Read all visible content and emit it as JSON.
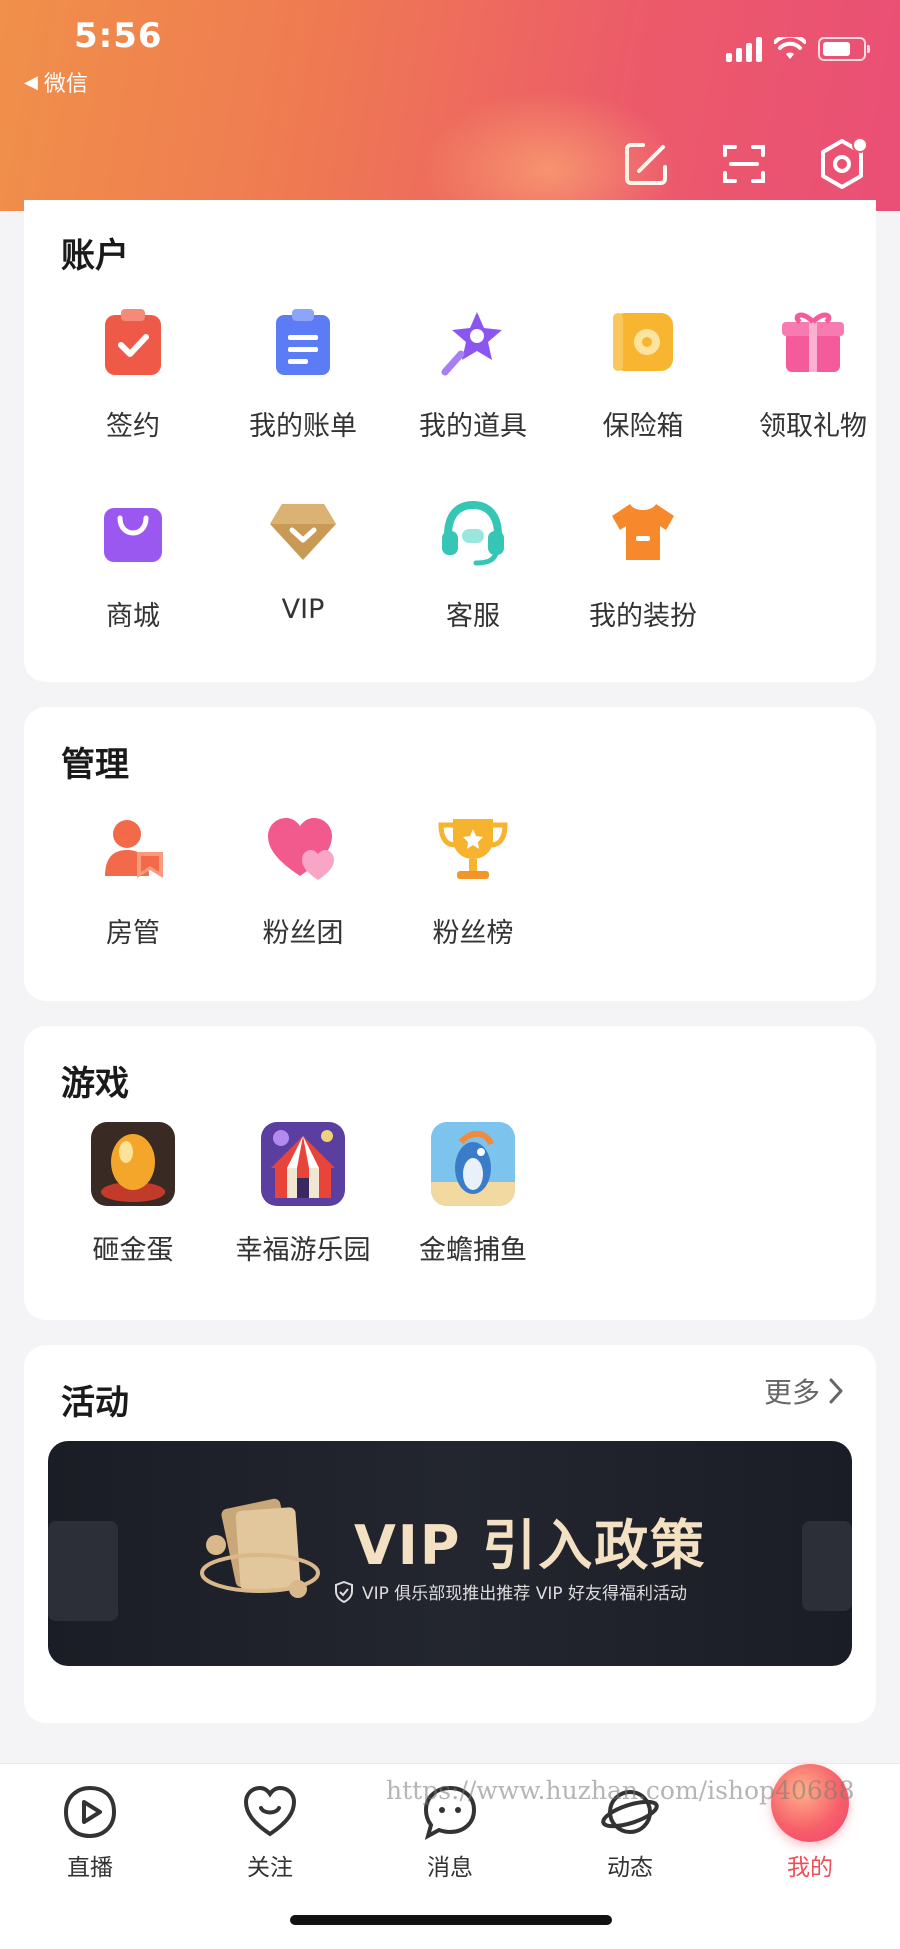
{
  "status_bar": {
    "time": "5:56",
    "back_app": "微信"
  },
  "header_actions": [
    {
      "icon": "edit-icon"
    },
    {
      "icon": "scan-icon"
    },
    {
      "icon": "settings-gear-icon"
    }
  ],
  "account": {
    "title": "账户",
    "items": [
      {
        "label": "签约",
        "icon": "clipboard-check-icon",
        "color": "#ef5a48"
      },
      {
        "label": "我的账单",
        "icon": "bill-icon",
        "color": "#5b7cf5"
      },
      {
        "label": "我的道具",
        "icon": "magic-wand-star-icon",
        "color": "#8b56f0"
      },
      {
        "label": "保险箱",
        "icon": "safe-box-icon",
        "color": "#f7b530"
      },
      {
        "label": "领取礼物",
        "icon": "gift-box-icon",
        "color": "#f55a9a"
      },
      {
        "label": "商城",
        "icon": "shopping-bag-icon",
        "color": "#9b58f0"
      },
      {
        "label": "VIP",
        "icon": "vip-diamond-icon",
        "color": "#c89a55"
      },
      {
        "label": "客服",
        "icon": "headset-icon",
        "color": "#36c6b6"
      },
      {
        "label": "我的装扮",
        "icon": "tshirt-icon",
        "color": "#f7882c"
      }
    ]
  },
  "manage": {
    "title": "管理",
    "items": [
      {
        "label": "房管",
        "icon": "room-admin-icon",
        "color": "#f26a4a"
      },
      {
        "label": "粉丝团",
        "icon": "hearts-icon",
        "color": "#f25a8e"
      },
      {
        "label": "粉丝榜",
        "icon": "trophy-icon",
        "color": "#f7b22e"
      }
    ]
  },
  "games": {
    "title": "游戏",
    "items": [
      {
        "label": "砸金蛋",
        "icon": "golden-egg-game-icon"
      },
      {
        "label": "幸福游乐园",
        "icon": "circus-tent-game-icon"
      },
      {
        "label": "金蟾捕鱼",
        "icon": "fishing-game-icon"
      }
    ]
  },
  "activity": {
    "title": "活动",
    "more": "更多",
    "banner_title": "VIP 引入政策",
    "banner_subtitle": "VIP 俱乐部现推出推荐 VIP 好友得福利活动"
  },
  "tabbar": [
    {
      "label": "直播",
      "icon": "live-play-icon",
      "active": false
    },
    {
      "label": "关注",
      "icon": "follow-heart-icon",
      "active": false
    },
    {
      "label": "消息",
      "icon": "message-bubble-icon",
      "active": false
    },
    {
      "label": "动态",
      "icon": "planet-feed-icon",
      "active": false
    },
    {
      "label": "我的",
      "icon": "me-avatar-icon",
      "active": true
    }
  ],
  "watermark": "https://www.huzhan.com/ishop40688",
  "colors": {
    "accent": "#ef4e5a",
    "header_start": "#f0904a",
    "header_end": "#ea4f76"
  }
}
